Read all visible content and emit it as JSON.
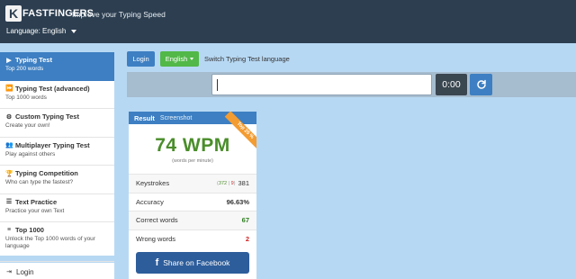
{
  "header": {
    "logo_k": "K",
    "logo_text": "FASTFINGERS",
    "slogan": "Improve your Typing Speed",
    "language_label": "Language: English"
  },
  "sidebar": {
    "items": [
      {
        "title": "Typing Test",
        "sub": "Top 200 words",
        "icon": "play-icon",
        "active": true
      },
      {
        "title": "Typing Test (advanced)",
        "sub": "Top 1000 words",
        "icon": "fast-forward-icon",
        "active": false
      },
      {
        "title": "Custom Typing Test",
        "sub": "Create your own!",
        "icon": "gears-icon",
        "active": false
      },
      {
        "title": "Multiplayer Typing Test",
        "sub": "Play against others",
        "icon": "users-icon",
        "active": false
      },
      {
        "title": "Typing Competition",
        "sub": "Who can type the fastest?",
        "icon": "trophy-icon",
        "active": false
      },
      {
        "title": "Text Practice",
        "sub": "Practice your own Text",
        "icon": "text-icon",
        "active": false
      },
      {
        "title": "Top 1000",
        "sub": "Unlock the Top 1000 words of your language",
        "icon": "list-icon",
        "active": false
      }
    ],
    "login_label": "Login"
  },
  "toolbar": {
    "login_label": "Login",
    "language_button": "English",
    "switch_label": "Switch Typing Test language"
  },
  "typing": {
    "input_value": "",
    "timer": "0:00"
  },
  "result": {
    "title": "Result",
    "tab": "Screenshot",
    "ribbon": "Top 25 %",
    "wpm": "74 WPM",
    "wpm_sub": "(words per minute)",
    "keystrokes_label": "Keystrokes",
    "keystrokes_correct": "372",
    "keystrokes_wrong": "9",
    "keystrokes_total": "381",
    "accuracy_label": "Accuracy",
    "accuracy_value": "96.63%",
    "correct_label": "Correct words",
    "correct_value": "67",
    "wrong_label": "Wrong words",
    "wrong_value": "2",
    "share_label": "Share on Facebook"
  },
  "colors": {
    "header_bg": "#2c3e50",
    "page_bg": "#b7d8f3",
    "primary": "#3d7fc2",
    "success": "#52b848",
    "wpm_green": "#4a8d2a",
    "facebook": "#2d5d9b",
    "ribbon": "#f39c32"
  }
}
